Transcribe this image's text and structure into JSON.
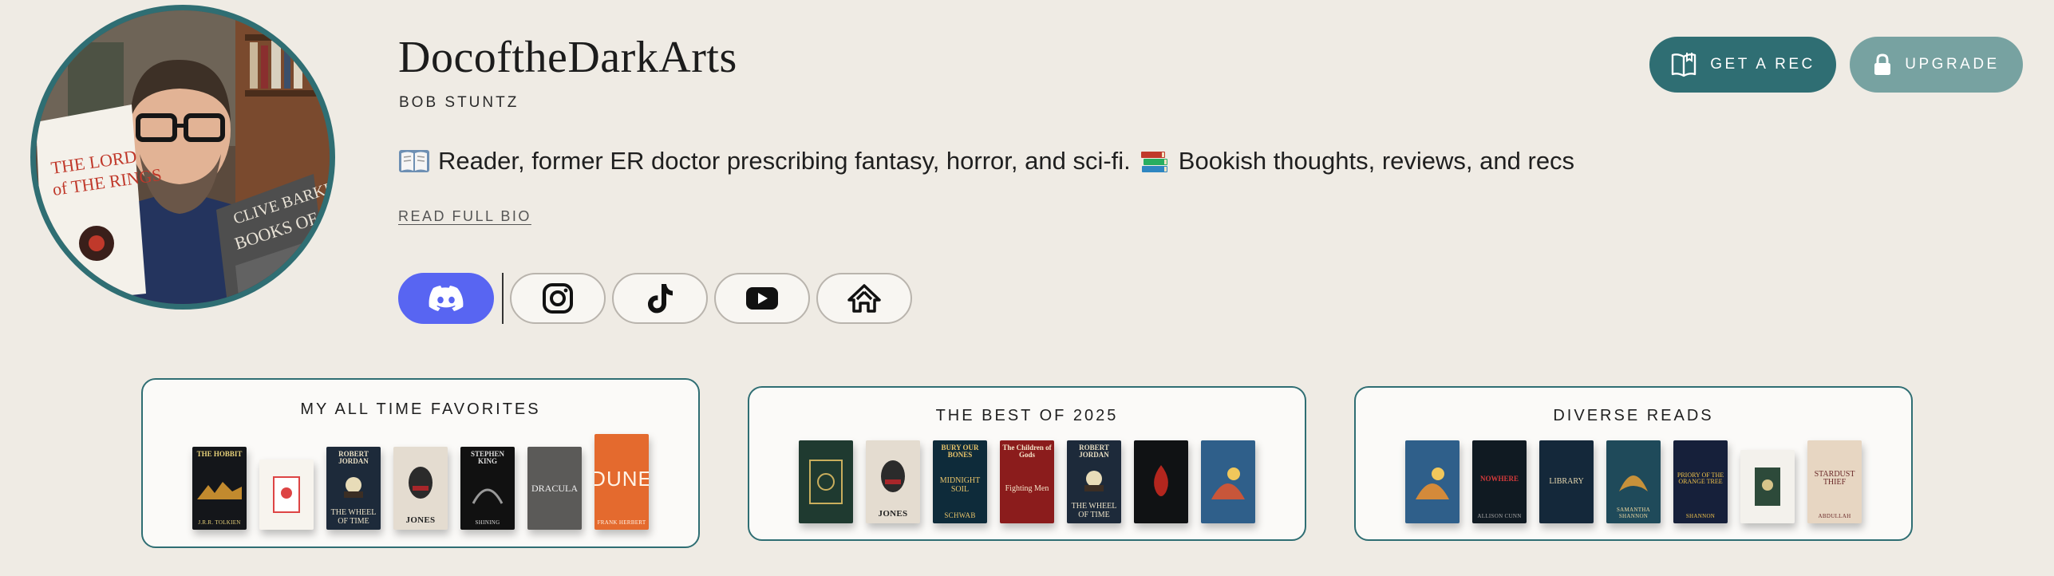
{
  "profile": {
    "username": "DocoftheDarkArts",
    "real_name": "BOB STUNTZ",
    "bio": "Reader, former ER doctor prescribing fantasy, horror, and sci-fi.",
    "bio_tail": "Bookish thoughts, reviews, and recs",
    "read_full_bio": "READ FULL BIO"
  },
  "actions": {
    "get_rec": "GET A REC",
    "upgrade": "UPGRADE"
  },
  "socials": [
    "discord-icon",
    "instagram-icon",
    "tiktok-icon",
    "youtube-icon",
    "storygraph-icon"
  ],
  "colors": {
    "background": "#efebe4",
    "accent_teal": "#2f6e73",
    "upgrade_teal": "#77a2a1",
    "discord": "#5865f2"
  },
  "shelves": [
    {
      "title": "MY ALL TIME FAVORITES",
      "books": [
        {
          "top": "THE HOBBIT",
          "mid": "",
          "bot": "J.R.R. TOLKIEN"
        },
        {
          "top": "",
          "mid": "",
          "bot": ""
        },
        {
          "top": "ROBERT JORDAN",
          "mid": "THE WHEEL OF TIME",
          "bot": ""
        },
        {
          "top": "",
          "mid": "",
          "bot": "JONES"
        },
        {
          "top": "STEPHEN KING",
          "mid": "",
          "bot": "SHINING"
        },
        {
          "top": "",
          "mid": "DRACULA",
          "bot": ""
        },
        {
          "top": "",
          "mid": "DUNE",
          "bot": "FRANK HERBERT"
        }
      ]
    },
    {
      "title": "THE BEST OF 2025",
      "books": [
        {
          "top": "",
          "mid": "",
          "bot": ""
        },
        {
          "top": "",
          "mid": "",
          "bot": "JONES"
        },
        {
          "top": "BURY OUR BONES",
          "mid": "MIDNIGHT SOIL",
          "bot": "SCHWAB"
        },
        {
          "top": "The Children of Gods",
          "mid": "Fighting Men",
          "bot": ""
        },
        {
          "top": "ROBERT JORDAN",
          "mid": "THE WHEEL OF TIME",
          "bot": ""
        },
        {
          "top": "",
          "mid": "",
          "bot": ""
        },
        {
          "top": "",
          "mid": "",
          "bot": ""
        }
      ]
    },
    {
      "title": "DIVERSE READS",
      "books": [
        {
          "top": "",
          "mid": "",
          "bot": ""
        },
        {
          "top": "",
          "mid": "NOWHERE",
          "bot": "ALLISON CUNN"
        },
        {
          "top": "",
          "mid": "LIBRARY",
          "bot": ""
        },
        {
          "top": "",
          "mid": "",
          "bot": "SAMANTHA SHANNON"
        },
        {
          "top": "",
          "mid": "PRIORY OF THE ORANGE TREE",
          "bot": "SHANNON"
        },
        {
          "top": "",
          "mid": "",
          "bot": ""
        },
        {
          "top": "",
          "mid": "STARDUST THIEF",
          "bot": "ABDULLAH"
        }
      ]
    }
  ]
}
